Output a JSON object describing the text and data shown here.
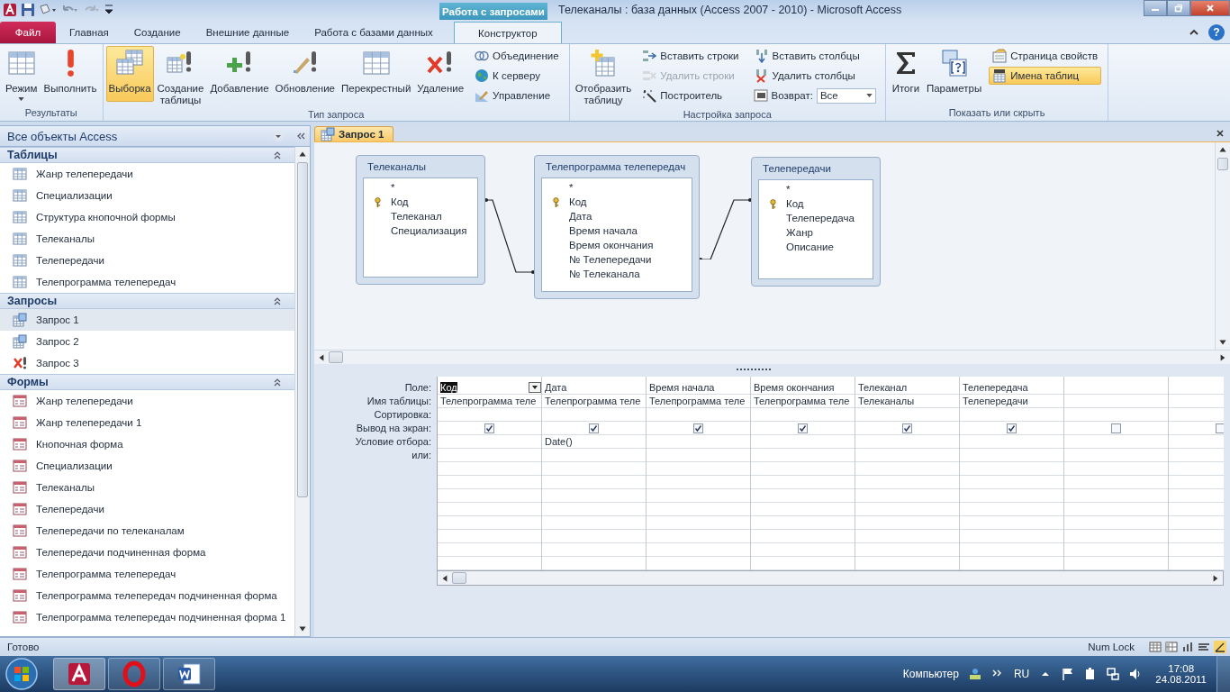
{
  "window": {
    "title": "Телеканалы : база данных (Access 2007 - 2010)  -  Microsoft Access",
    "help": "?"
  },
  "ribbon": {
    "context_label": "Работа с запросами",
    "tabs": [
      {
        "label": "Файл",
        "kind": "file",
        "selected": false
      },
      {
        "label": "Главная",
        "kind": "normal",
        "selected": false
      },
      {
        "label": "Создание",
        "kind": "normal",
        "selected": false
      },
      {
        "label": "Внешние данные",
        "kind": "normal",
        "selected": false
      },
      {
        "label": "Работа с базами данных",
        "kind": "normal",
        "selected": false
      },
      {
        "label": "Конструктор",
        "kind": "context",
        "selected": true
      }
    ],
    "groups": [
      {
        "label": "Результаты",
        "large_buttons": [
          {
            "label": "Режим",
            "selected": false,
            "dropdown": true
          },
          {
            "label": "Выполнить",
            "selected": false,
            "dropdown": false
          }
        ]
      },
      {
        "label": "Тип запроса",
        "large_buttons": [
          {
            "label": "Выборка",
            "selected": true,
            "dropdown": false
          },
          {
            "label": "Создание таблицы",
            "selected": false,
            "dropdown": false
          },
          {
            "label": "Добавление",
            "selected": false,
            "dropdown": false
          },
          {
            "label": "Обновление",
            "selected": false,
            "dropdown": false
          },
          {
            "label": "Перекрестный",
            "selected": false,
            "dropdown": false
          },
          {
            "label": "Удаление",
            "selected": false,
            "dropdown": false
          }
        ],
        "small_columns": [
          [
            {
              "label": "Объединение",
              "kind": "button",
              "selected": false,
              "disabled": false
            },
            {
              "label": "К серверу",
              "kind": "button",
              "selected": false,
              "disabled": false
            },
            {
              "label": "Управление",
              "kind": "button",
              "selected": false,
              "disabled": false
            }
          ]
        ]
      },
      {
        "label": "Настройка запроса",
        "large_buttons": [
          {
            "label": "Отобразить таблицу",
            "selected": false,
            "dropdown": false
          }
        ],
        "small_columns": [
          [
            {
              "label": "Вставить строки",
              "kind": "button",
              "selected": false,
              "disabled": false
            },
            {
              "label": "Удалить строки",
              "kind": "button",
              "selected": false,
              "disabled": true
            },
            {
              "label": "Построитель",
              "kind": "button",
              "selected": false,
              "disabled": false
            }
          ],
          [
            {
              "label": "Вставить столбцы",
              "kind": "button",
              "selected": false,
              "disabled": false
            },
            {
              "label": "Удалить столбцы",
              "kind": "button",
              "selected": false,
              "disabled": false
            },
            {
              "label": "Возврат:",
              "kind": "combo",
              "value": "Все"
            }
          ]
        ]
      },
      {
        "label": "Показать или скрыть",
        "large_buttons": [
          {
            "label": "Итоги",
            "selected": false,
            "dropdown": false
          },
          {
            "label": "Параметры",
            "selected": false,
            "dropdown": false
          }
        ],
        "small_columns": [
          [
            {
              "label": "Страница свойств",
              "kind": "button",
              "selected": false,
              "disabled": false
            },
            {
              "label": "Имена таблиц",
              "kind": "button",
              "selected": true,
              "disabled": false
            }
          ]
        ]
      }
    ]
  },
  "navigation": {
    "title": "Все объекты Access",
    "sections": [
      {
        "title": "Таблицы",
        "expanded": true,
        "items": [
          {
            "label": "Жанр телепередачи",
            "kind": "table",
            "selected": false
          },
          {
            "label": "Специализации",
            "kind": "table",
            "selected": false
          },
          {
            "label": "Структура кнопочной формы",
            "kind": "table",
            "selected": false
          },
          {
            "label": "Телеканалы",
            "kind": "table",
            "selected": false
          },
          {
            "label": "Телепередачи",
            "kind": "table",
            "selected": false
          },
          {
            "label": "Телепрограмма телепередач",
            "kind": "table",
            "selected": false
          }
        ]
      },
      {
        "title": "Запросы",
        "expanded": true,
        "items": [
          {
            "label": "Запрос 1",
            "kind": "query",
            "selected": true
          },
          {
            "label": "Запрос 2",
            "kind": "query",
            "selected": false
          },
          {
            "label": "Запрос 3",
            "kind": "delete_query",
            "selected": false
          }
        ]
      },
      {
        "title": "Формы",
        "expanded": true,
        "items": [
          {
            "label": "Жанр телепередачи",
            "kind": "form",
            "selected": false
          },
          {
            "label": "Жанр телепередачи 1",
            "kind": "form",
            "selected": false
          },
          {
            "label": "Кнопочная форма",
            "kind": "form",
            "selected": false
          },
          {
            "label": "Специализации",
            "kind": "form",
            "selected": false
          },
          {
            "label": "Телеканалы",
            "kind": "form",
            "selected": false
          },
          {
            "label": "Телепередачи",
            "kind": "form",
            "selected": false
          },
          {
            "label": "Телепередачи по телеканалам",
            "kind": "form",
            "selected": false
          },
          {
            "label": "Телепередачи подчиненная форма",
            "kind": "form",
            "selected": false
          },
          {
            "label": "Телепрограмма телепередач",
            "kind": "form",
            "selected": false
          },
          {
            "label": "Телепрограмма телепередач подчиненная форма",
            "kind": "form",
            "selected": false
          },
          {
            "label": "Телепрограмма телепередач подчиненная форма 1",
            "kind": "form",
            "selected": false
          }
        ]
      }
    ]
  },
  "document_tabs": [
    {
      "label": "Запрос 1",
      "selected": true
    }
  ],
  "design_tables": [
    {
      "title": "Телеканалы",
      "fields": [
        {
          "name": "*",
          "key": false
        },
        {
          "name": "Код",
          "key": true
        },
        {
          "name": "Телеканал",
          "key": false
        },
        {
          "name": "Специализация",
          "key": false
        }
      ]
    },
    {
      "title": "Телепрограмма телепередач",
      "fields": [
        {
          "name": "*",
          "key": false
        },
        {
          "name": "Код",
          "key": true
        },
        {
          "name": "Дата",
          "key": false
        },
        {
          "name": "Время начала",
          "key": false
        },
        {
          "name": "Время окончания",
          "key": false
        },
        {
          "name": "№ Телепередачи",
          "key": false
        },
        {
          "name": "№ Телеканала",
          "key": false
        }
      ]
    },
    {
      "title": "Телепередачи",
      "fields": [
        {
          "name": "*",
          "key": false
        },
        {
          "name": "Код",
          "key": true
        },
        {
          "name": "Телепередача",
          "key": false
        },
        {
          "name": "Жанр",
          "key": false
        },
        {
          "name": "Описание",
          "key": false
        }
      ]
    }
  ],
  "query_grid": {
    "row_labels": [
      "Поле:",
      "Имя таблицы:",
      "Сортировка:",
      "Вывод на экран:",
      "Условие отбора:",
      "или:"
    ],
    "columns": [
      {
        "field": "Код",
        "table": "Телепрограмма теле",
        "show": true,
        "selected": true
      },
      {
        "field": "Дата",
        "table": "Телепрограмма теле",
        "show": true,
        "criteria": "Date()",
        "selected": false
      },
      {
        "field": "Время начала",
        "table": "Телепрограмма теле",
        "show": true,
        "selected": false
      },
      {
        "field": "Время окончания",
        "table": "Телепрограмма теле",
        "show": true,
        "selected": false
      },
      {
        "field": "Телеканал",
        "table": "Телеканалы",
        "show": true,
        "selected": false
      },
      {
        "field": "Телепередача",
        "table": "Телепередачи",
        "show": true,
        "selected": false
      },
      {
        "show": false,
        "selected": false
      },
      {
        "show": false,
        "selected": false
      }
    ]
  },
  "status_bar": {
    "text": "Готово",
    "indicator": "Num Lock"
  },
  "taskbar": {
    "apps": [
      {
        "kind": "database",
        "selected": true
      },
      {
        "kind": "browser",
        "selected": false
      },
      {
        "kind": "document",
        "selected": false
      }
    ],
    "toolbar_label": "Компьютер",
    "language": "RU",
    "time": "17:08",
    "date": "24.08.2011"
  }
}
